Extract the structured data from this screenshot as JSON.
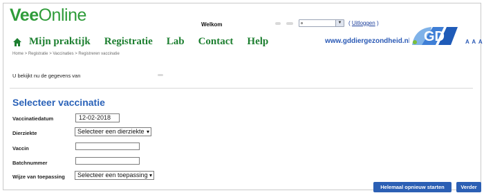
{
  "header": {
    "logo_vee": "Vee",
    "logo_online": "Online",
    "welcome": "Welkom",
    "logout_open": "(",
    "logout_link": "Uitloggen",
    "logout_close": ")",
    "site_url": "www.gddiergezondheid.nl",
    "logo_text": "GD",
    "font_size_links": "A A A"
  },
  "nav": {
    "items": [
      "Mijn praktijk",
      "Registratie",
      "Lab",
      "Contact",
      "Help"
    ]
  },
  "breadcrumb": "Home > Registratie > Vaccinaties > Registreren vaccinatie",
  "info_text": "U bekijkt nu de gegevens van",
  "form": {
    "title": "Selecteer vaccinatie",
    "vaccination_date_label": "Vaccinatiedatum",
    "vaccination_date_value": "12-02-2018",
    "disease_label": "Dierziekte",
    "disease_selected": "Selecteer een dierziekte",
    "vaccine_label": "Vaccin",
    "vaccine_value": "",
    "batch_label": "Batchnummer",
    "batch_value": "",
    "method_label": "Wijze van toepassing",
    "method_selected": "Selecteer een toepassing"
  },
  "buttons": {
    "restart": "Helemaal opnieuw starten",
    "next": "Verder"
  },
  "colors": {
    "brand_green": "#2f9c3a",
    "accent_blue": "#2a62b8",
    "button_blue": "#2b5fb4"
  }
}
